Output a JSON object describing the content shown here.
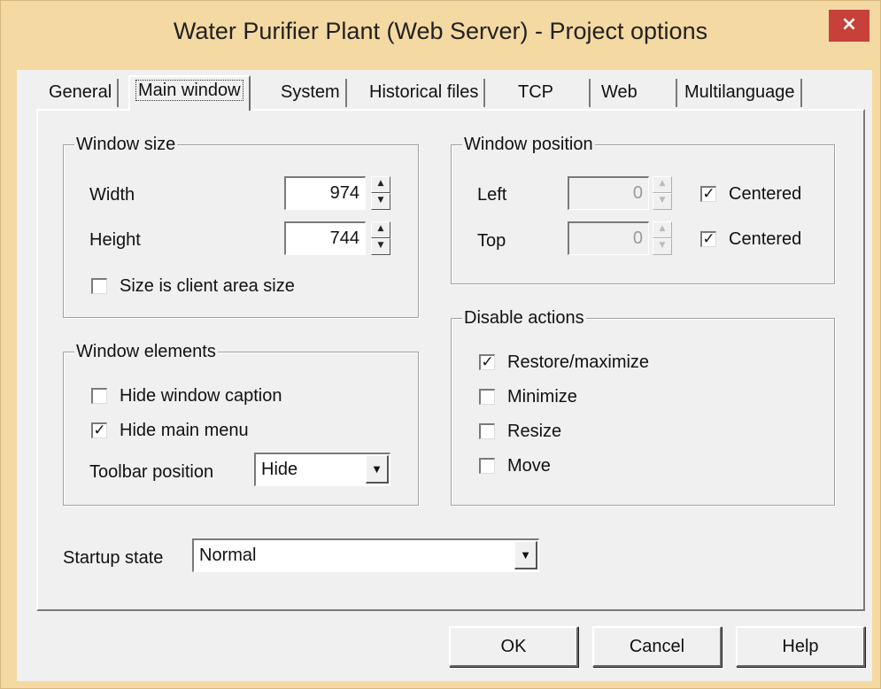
{
  "window": {
    "title": "Water Purifier Plant (Web Server) - Project options",
    "close_glyph": "×"
  },
  "tabs": [
    {
      "label": "General"
    },
    {
      "label": "Main window",
      "active": true
    },
    {
      "label": "System"
    },
    {
      "label": "Historical files"
    },
    {
      "label": "TCP"
    },
    {
      "label": "Web"
    },
    {
      "label": "Multilanguage"
    }
  ],
  "window_size": {
    "title": "Window size",
    "width_label": "Width",
    "width_value": "974",
    "height_label": "Height",
    "height_value": "744",
    "client_area_label": "Size is client area size",
    "client_area_checked": false
  },
  "window_position": {
    "title": "Window position",
    "left_label": "Left",
    "left_value": "0",
    "left_centered_label": "Centered",
    "left_centered_checked": true,
    "top_label": "Top",
    "top_value": "0",
    "top_centered_label": "Centered",
    "top_centered_checked": true
  },
  "window_elements": {
    "title": "Window elements",
    "hide_caption_label": "Hide window caption",
    "hide_caption_checked": false,
    "hide_menu_label": "Hide main menu",
    "hide_menu_checked": true,
    "toolbar_label": "Toolbar position",
    "toolbar_value": "Hide"
  },
  "disable_actions": {
    "title": "Disable actions",
    "restore_label": "Restore/maximize",
    "restore_checked": true,
    "minimize_label": "Minimize",
    "minimize_checked": false,
    "resize_label": "Resize",
    "resize_checked": false,
    "move_label": "Move",
    "move_checked": false
  },
  "startup": {
    "label": "Startup state",
    "value": "Normal"
  },
  "buttons": {
    "ok": "OK",
    "cancel": "Cancel",
    "help": "Help"
  },
  "glyphs": {
    "check": "✓",
    "spin_up": "▲",
    "spin_down": "▼",
    "dropdown": "▼"
  },
  "colors": {
    "frame": "#f4d9a2",
    "close": "#c7403a",
    "face": "#f0f0f0"
  }
}
